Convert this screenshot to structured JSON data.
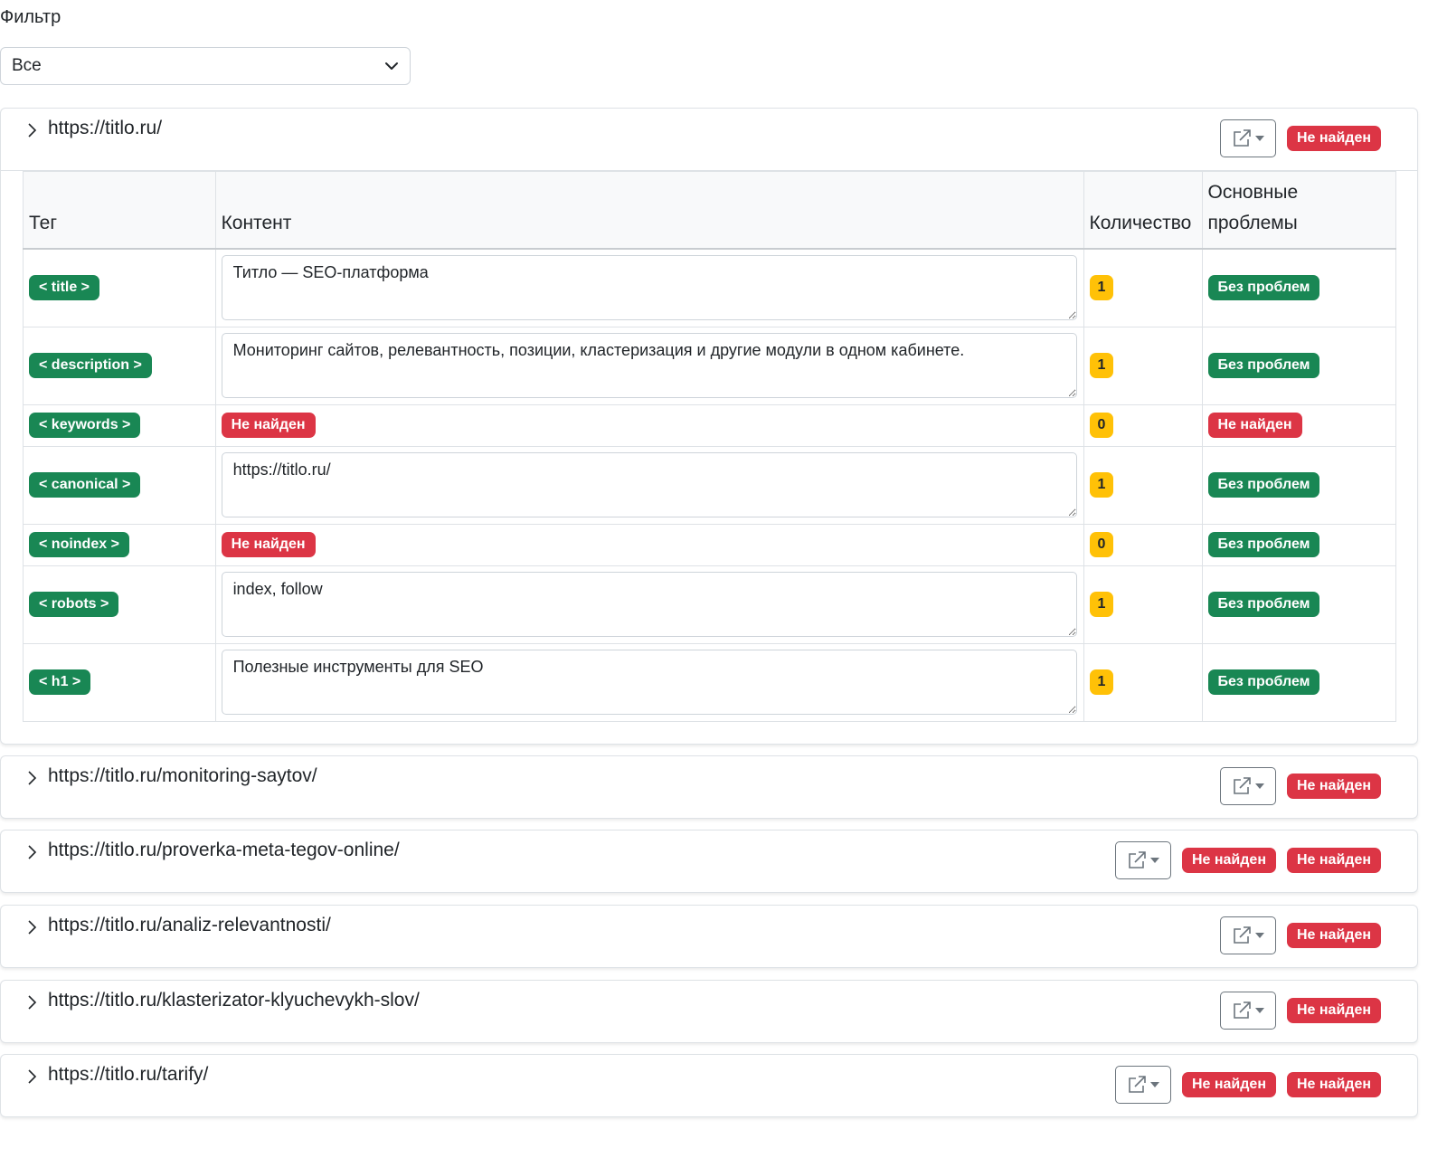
{
  "filter": {
    "label": "Фильтр",
    "selected": "Все"
  },
  "not_found": "Не найден",
  "table": {
    "headers": {
      "tag": "Тег",
      "content": "Контент",
      "count": "Количество",
      "issues": "Основные проблемы"
    },
    "rows": [
      {
        "tag": "< title >",
        "content": "Титло — SEO-платформа",
        "count": "1",
        "issue": "Без проблем"
      },
      {
        "tag": "< description >",
        "content": "Мониторинг сайтов, релевантность, позиции, кластеризация и другие модули в одном кабинете.",
        "count": "1",
        "issue": "Без проблем"
      },
      {
        "tag": "< keywords >",
        "content": "Не найден",
        "count": "0",
        "issue": "Не найден"
      },
      {
        "tag": "< canonical >",
        "content": "https://titlo.ru/",
        "count": "1",
        "issue": "Без проблем"
      },
      {
        "tag": "< noindex >",
        "content": "Не найден",
        "count": "0",
        "issue": "Без проблем"
      },
      {
        "tag": "< robots >",
        "content": "index, follow",
        "count": "1",
        "issue": "Без проблем"
      },
      {
        "tag": "< h1 >",
        "content": "Полезные инструменты для SEO",
        "count": "1",
        "issue": "Без проблем"
      }
    ]
  },
  "pages": [
    {
      "url": "https://titlo.ru/",
      "badges": [
        "Не найден"
      ]
    },
    {
      "url": "https://titlo.ru/monitoring-saytov/",
      "badges": [
        "Не найден"
      ]
    },
    {
      "url": "https://titlo.ru/proverka-meta-tegov-online/",
      "badges": [
        "Не найден",
        "Не найден"
      ]
    },
    {
      "url": "https://titlo.ru/analiz-relevantnosti/",
      "badges": [
        "Не найден"
      ]
    },
    {
      "url": "https://titlo.ru/klasterizator-klyuchevykh-slov/",
      "badges": [
        "Не найден"
      ]
    },
    {
      "url": "https://titlo.ru/tarify/",
      "badges": [
        "Не найден",
        "Не найден"
      ]
    }
  ],
  "icons": {
    "expand": "chevron-right-icon",
    "open_external": "external-link-icon",
    "dropdown": "chevron-down-icon"
  },
  "colors": {
    "danger": "#dc3545",
    "success": "#198754",
    "warning": "#ffc107"
  }
}
